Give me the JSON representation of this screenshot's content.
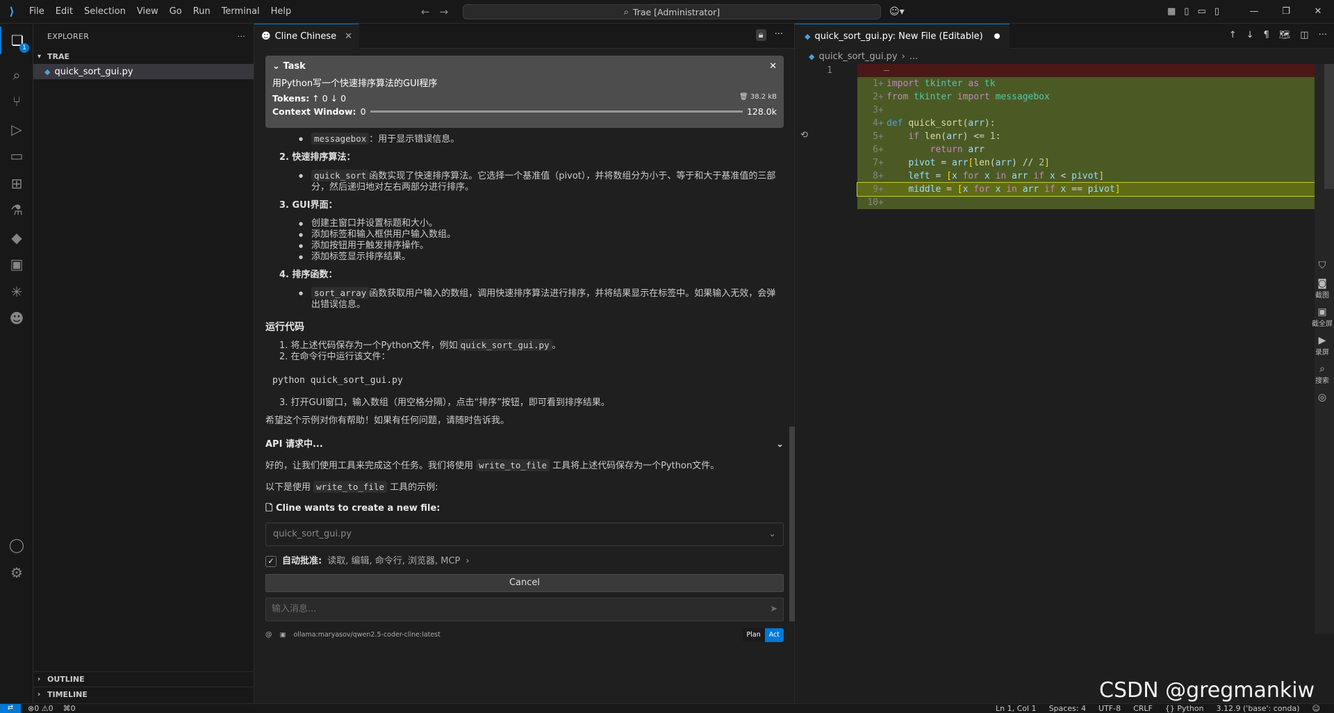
{
  "titlebar": {
    "menu": [
      "File",
      "Edit",
      "Selection",
      "View",
      "Go",
      "Run",
      "Terminal",
      "Help"
    ],
    "command_center": "Trae [Administrator]"
  },
  "activity": {
    "explorer_badge": "1"
  },
  "sidebar": {
    "title": "EXPLORER",
    "folder": "TRAE",
    "files": [
      "quick_sort_gui.py"
    ],
    "outline": "OUTLINE",
    "timeline": "TIMELINE"
  },
  "cline": {
    "tab_label": "Cline Chinese",
    "task": {
      "label": "Task",
      "text": "用Python写一个快速排序算法的GUI程序",
      "tokens_label": "Tokens:",
      "tokens_up": "0",
      "tokens_down": "0",
      "size": "38.2 kB",
      "context_label": "Context Window:",
      "context_used": "0",
      "context_max": "128.0k"
    },
    "content": {
      "b_messagebox_code": "messagebox",
      "b_messagebox_text": "：用于显示错误信息。",
      "n2_title": "2. 快速排序算法：",
      "b_quicksort_code": "quick_sort",
      "b_quicksort_text": "函数实现了快速排序算法。它选择一个基准值（pivot），并将数组分为小于、等于和大于基准值的三部分，然后递归地对左右两部分进行排序。",
      "n3_title": "3. GUI界面：",
      "gui_items": [
        "创建主窗口并设置标题和大小。",
        "添加标签和输入框供用户输入数组。",
        "添加按钮用于触发排序操作。",
        "添加标签显示排序结果。"
      ],
      "n4_title": "4. 排序函数：",
      "b_sortarray_code": "sort_array",
      "b_sortarray_text": "函数获取用户输入的数组，调用快速排序算法进行排序，并将结果显示在标签中。如果输入无效，会弹出错误信息。",
      "run_heading": "运行代码",
      "run_1_text": "1. 将上述代码保存为一个Python文件，例如",
      "run_1_code": "quick_sort_gui.py",
      "run_1_end": "。",
      "run_2_text": "2. 在命令行中运行该文件：",
      "run_cmd": "python quick_sort_gui.py",
      "run_3_text": "3. 打开GUI窗口，输入数组（用空格分隔），点击“排序”按钮，即可看到排序结果。",
      "closing": "希望这个示例对你有帮助！如果有任何问题，请随时告诉我。",
      "api_title": "API 请求中...",
      "resp_1_a": "好的，让我们使用工具来完成这个任务。我们将使用",
      "resp_1_code": "write_to_file",
      "resp_1_b": "工具将上述代码保存为一个Python文件。",
      "resp_2_a": "以下是使用",
      "resp_2_code": "write_to_file",
      "resp_2_b": "工具的示例:",
      "create_label": "Cline wants to create a new file:",
      "new_file": "quick_sort_gui.py",
      "auto_label": "自动批准:",
      "auto_items": "读取, 编辑, 命令行, 浏览器, MCP",
      "cancel": "Cancel",
      "input_placeholder": "输入消息...",
      "model": "ollama:maryasov/qwen2.5-coder-cline:latest",
      "plan": "Plan",
      "act": "Act"
    }
  },
  "editor": {
    "tab_label": "quick_sort_gui.py: New File (Editable)",
    "breadcrumb_file": "quick_sort_gui.py",
    "breadcrumb_more": "...",
    "old_line_no": "1",
    "lines": [
      {
        "n": "1",
        "mark": "+"
      },
      {
        "n": "2",
        "mark": "+"
      },
      {
        "n": "3",
        "mark": "+"
      },
      {
        "n": "4",
        "mark": "+"
      },
      {
        "n": "5",
        "mark": "+"
      },
      {
        "n": "6",
        "mark": "+"
      },
      {
        "n": "7",
        "mark": "+"
      },
      {
        "n": "8",
        "mark": "+"
      },
      {
        "n": "9",
        "mark": "+"
      },
      {
        "n": "10",
        "mark": "+"
      }
    ],
    "side_tools": [
      "截图",
      "截全屏",
      "录屏",
      "搜索"
    ]
  },
  "statusbar": {
    "errors": "0",
    "warnings": "0",
    "ports": "0",
    "position": "Ln 1, Col 1",
    "spaces": "Spaces: 4",
    "encoding": "UTF-8",
    "eol": "CRLF",
    "language": "Python",
    "interpreter": "3.12.9 ('base': conda)"
  },
  "watermark": "CSDN @gregmankiw"
}
